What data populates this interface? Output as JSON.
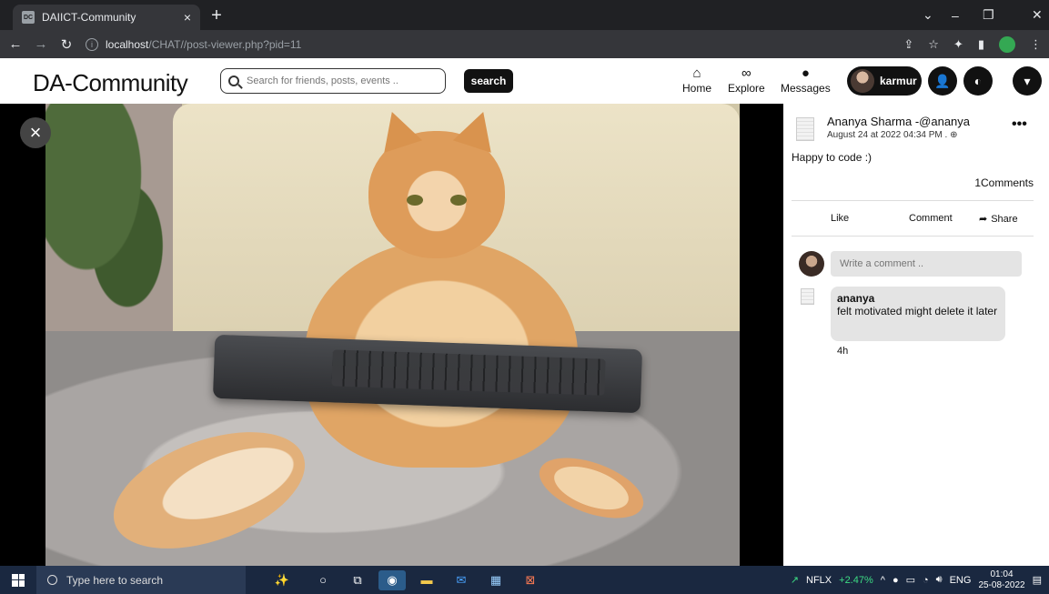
{
  "browser": {
    "tab_title": "DAIICT-Community",
    "favicon_text": "DC",
    "tab_close": "×",
    "new_tab": "+",
    "url_host": "localhost",
    "url_path": "/CHAT//post-viewer.php?pid=11",
    "controls": {
      "dropdown": "⌄",
      "minimize": "–",
      "restore": "❐",
      "close": "✕"
    }
  },
  "header": {
    "logo": "DA-Community",
    "search_placeholder": "Search for friends, posts, events ..",
    "search_button": "search",
    "nav": [
      {
        "label": "Home",
        "icon": "home-icon"
      },
      {
        "label": "Explore",
        "icon": "binoculars-icon"
      },
      {
        "label": "Messages",
        "icon": "chat-icon"
      }
    ],
    "user_name": "karmur"
  },
  "viewer": {
    "close_label": "×"
  },
  "post": {
    "author": "Ananya Sharma -@ananya",
    "date": "August 24 at 2022 04:34 PM .",
    "more": "•••",
    "text": "Happy to code :)",
    "comment_count": "1Comments",
    "actions": {
      "like": "Like",
      "comment": "Comment",
      "share": "Share"
    },
    "comment_placeholder": "Write a comment ..",
    "comments": [
      {
        "name": "ananya",
        "text": "felt motivated might delete it later",
        "time": "4h"
      }
    ]
  },
  "taskbar": {
    "search_placeholder": "Type here to search",
    "ticker": "NFLX",
    "ticker_change": "+2.47%",
    "language": "ENG",
    "time": "01:04",
    "date": "25-08-2022"
  },
  "colors": {
    "ticker_positive": "#3ddc84",
    "taskbar_bg": "#1a2840",
    "chrome_dark": "#202124"
  }
}
